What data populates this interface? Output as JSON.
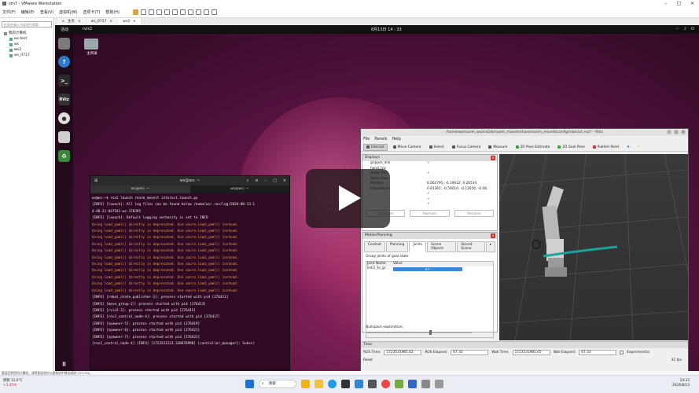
{
  "vmware": {
    "title": "vm7 - VMware Workstation",
    "menus": [
      "文件(F)",
      "编辑(E)",
      "查看(V)",
      "虚拟机(M)",
      "选项卡(T)",
      "帮助(H)"
    ],
    "library": {
      "search": "在此处键入内容进行搜索",
      "items": [
        {
          "label": "我的计算机",
          "level": 0
        },
        {
          "label": "ws-test",
          "level": 1
        },
        {
          "label": "ws",
          "level": 1
        },
        {
          "label": "ws3",
          "level": 1
        },
        {
          "label": "ws_0717",
          "level": 1
        }
      ]
    },
    "tabs": [
      {
        "label": "主页"
      },
      {
        "label": "ws_0717"
      },
      {
        "label": "ws3"
      }
    ],
    "status_hint": "要返回到您的计算机，请将鼠标指针从虚拟机中移出或按 Ctrl+Alt。"
  },
  "ubuntu": {
    "activities": "活动",
    "app": "rviz2",
    "clock": "8月13日  14 : 33",
    "home_label": "主目录"
  },
  "terminal": {
    "title": "ws@ws: ~",
    "tabs": [
      "ws@ws: ~",
      "ws@ws: ~"
    ],
    "lines": [
      {
        "text": "ws@ws:~$ ros2 launch roarm_moveit interact.launch.py",
        "warn": false
      },
      {
        "text": "[INFO] [launch]: All log files can be found below /home/ws/.ros/log/2024-08-13-1",
        "warn": false
      },
      {
        "text": "4-40-21-047541-ws-278395",
        "warn": false
      },
      {
        "text": "[INFO] [launch]: Default logging verbosity is set to INFO",
        "warn": false
      },
      {
        "text": "Using load_yaml() directly is deprecated. Use xacro.load_yaml() instead.",
        "warn": true
      },
      {
        "text": "Using load_yaml() directly is deprecated. Use xacro.load_yaml() instead.",
        "warn": true
      },
      {
        "text": "Using load_yaml() directly is deprecated. Use xacro.load_yaml() instead.",
        "warn": true
      },
      {
        "text": "Using load_yaml() directly is deprecated. Use xacro.load_yaml() instead.",
        "warn": true
      },
      {
        "text": "Using load_yaml() directly is deprecated. Use xacro.load_yaml() instead.",
        "warn": true
      },
      {
        "text": "Using load_yaml() directly is deprecated. Use xacro.load_yaml() instead.",
        "warn": true
      },
      {
        "text": "Using load_yaml() directly is deprecated. Use xacro.load_yaml() instead.",
        "warn": true
      },
      {
        "text": "Using load_yaml() directly is deprecated. Use xacro.load_yaml() instead.",
        "warn": true
      },
      {
        "text": "Using load_yaml() directly is deprecated. Use xacro.load_yaml() instead.",
        "warn": true
      },
      {
        "text": "Using load_yaml() directly is deprecated. Use xacro.load_yaml() instead.",
        "warn": true
      },
      {
        "text": "Using load_yaml() directly is deprecated. Use xacro.load_yaml() instead.",
        "warn": true
      },
      {
        "text": "[INFO] [robot_state_publisher-1]: process started with pid [276411]",
        "warn": false
      },
      {
        "text": "[INFO] [move_group-2]: process started with pid [276413]",
        "warn": false
      },
      {
        "text": "[INFO] [rviz2-3]: process started with pid [276415]",
        "warn": false
      },
      {
        "text": "[INFO] [ros2_control_node-4]: process started with pid [276417]",
        "warn": false
      },
      {
        "text": "[INFO] [spawner-5]: process started with pid [276419]",
        "warn": false
      },
      {
        "text": "[INFO] [spawner-6]: process started with pid [276421]",
        "warn": false
      },
      {
        "text": "[INFO] [spawner-7]: process started with pid [276423]",
        "warn": false
      },
      {
        "text": "[ros2_control_node-4] [INFO] [1723531223.330676990] [controller_manager]: Subscr",
        "warn": false
      }
    ]
  },
  "rviz": {
    "title": "/home/ws/roarm_ws/install/roarm_moveit/share/roarm_moveit/config/interact.rviz* - RViz",
    "menu": [
      "File",
      "Panels",
      "Help"
    ],
    "tools": [
      {
        "label": "Interact",
        "active": true
      },
      {
        "label": "Move Camera",
        "active": false
      },
      {
        "label": "Select",
        "active": false
      },
      {
        "label": "Focus Camera",
        "active": false
      },
      {
        "label": "Measure",
        "active": false
      },
      {
        "label": "2D Pose Estimate",
        "active": false
      },
      {
        "label": "2D Goal Pose",
        "active": false
      },
      {
        "label": "Publish Point",
        "active": false
      }
    ],
    "displays": {
      "title": "Displays",
      "rows": [
        {
          "k": "gripper_link",
          "v": "✓"
        },
        {
          "k": "hand_tcp",
          "v": ""
        },
        {
          "k": "Show Trail",
          "v": "✓"
        },
        {
          "k": "Show Axes",
          "v": ""
        },
        {
          "k": "Position",
          "v": "0.062795; -0.19032; 0.26534"
        },
        {
          "k": "Orientation",
          "v": "0.81361; -0.56016; -0.12656; -0.08."
        },
        {
          "k": "",
          "v": "✓"
        },
        {
          "k": "",
          "v": "✓"
        },
        {
          "k": "",
          "v": "✓"
        }
      ],
      "buttons": [
        "Duplicate",
        "Remove",
        "Rename"
      ]
    },
    "motion": {
      "title": "MotionPlanning",
      "tabs": [
        {
          "label": "Context",
          "active": false
        },
        {
          "label": "Planning",
          "active": false
        },
        {
          "label": "Joints",
          "active": true
        },
        {
          "label": "Scene Objects",
          "active": false
        },
        {
          "label": "Stored Scene",
          "active": false
        }
      ],
      "group_label": "Group joints of goal state",
      "col_name": "Joint Name",
      "col_value": "Value",
      "joints": [
        {
          "name": "link1_to_gr...",
          "value": "67°",
          "fraction": 0.53
        }
      ],
      "nullspace": "Nullspace exploration:"
    },
    "time": {
      "title": "Time",
      "ros_time_label": "ROS Time:",
      "ros_time": "1723531985.02",
      "ros_elapsed_label": "ROS Elapsed:",
      "ros_elapsed": "67.33",
      "wall_time_label": "Wall Time:",
      "wall_time": "1723531985.05",
      "wall_elapsed_label": "Wall Elapsed:",
      "wall_elapsed": "67.33",
      "experimental": "Experimental",
      "reset": "Reset",
      "fps": "31 fps"
    }
  },
  "taskbar": {
    "weather": "阴转 11.0°C",
    "weather2": "+3.45%",
    "search": "搜索",
    "time": "14:33",
    "date": "2024/8/13"
  },
  "colors": {
    "vm_bg": "#f3f3f3",
    "terminal_bg": "#300a24",
    "warn": "#e8a13a",
    "rviz_bg": "#efefef",
    "view_bg": "#3a3a3a",
    "trail": "#1aa39a",
    "joint_bar": "#3b88d8"
  }
}
